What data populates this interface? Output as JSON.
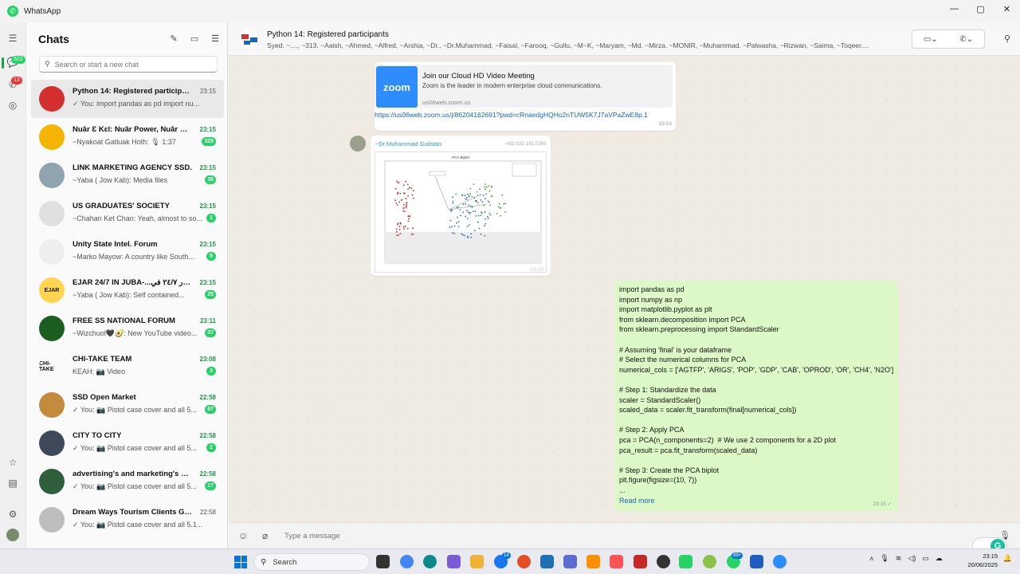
{
  "window": {
    "title": "WhatsApp",
    "minimize": "—",
    "maximize": "▢",
    "close": "✕"
  },
  "rail": {
    "chats_badge": "323",
    "status_badge": "13"
  },
  "sidebar": {
    "title": "Chats",
    "search_placeholder": "Search or start a new chat",
    "chats": [
      {
        "name": "Python 14: Registered participants",
        "preview": "✓ You: import pandas as pd import nu...",
        "time": "23:15",
        "count": "",
        "avatar_color": "#d32f2f",
        "avatar_text": ""
      },
      {
        "name": "Nuãr Ɛ Kɛl: Nuãr Power, Nuãr Bu...",
        "preview": "~Nyakoat Gatluak Hoth: 🎙 1:37",
        "time": "23:15",
        "count": "325",
        "avatar_color": "#f4b400",
        "avatar_text": ""
      },
      {
        "name": "LINK MARKETING AGENCY SSD.",
        "preview": "~Yaba      ( Jow Kab): Media files",
        "time": "23:15",
        "count": "35",
        "avatar_color": "#90a4ae",
        "avatar_text": ""
      },
      {
        "name": "US GRADUATES' SOCIETY",
        "preview": "~Chahan Ket Chan: Yeah, almost to so...",
        "time": "23:15",
        "count": "1",
        "avatar_color": "#e0e0e0",
        "avatar_text": ""
      },
      {
        "name": "Unity State Intel. Forum",
        "preview": "~Marko Mayow: A country like South...",
        "time": "23:15",
        "count": "5",
        "avatar_color": "#eeeeee",
        "avatar_text": ""
      },
      {
        "name": "EJAR 24/7 IN JUBA-...إيجار ٢٤/٧ في",
        "preview": "~Yaba      ( Jow Kab): Self contained...",
        "time": "23:15",
        "count": "25",
        "avatar_color": "#ffd54f",
        "avatar_text": "EJAR"
      },
      {
        "name": "FREE SS NATIONAL FORUM",
        "preview": "~Wizchuol🖤🥑: New YouTube video...",
        "time": "23:11",
        "count": "37",
        "avatar_color": "#1b5e20",
        "avatar_text": ""
      },
      {
        "name": "CHI-TAKE TEAM",
        "preview": "KEAH: 📷 Video",
        "time": "23:08",
        "count": "3",
        "avatar_color": "#fafafa",
        "avatar_text": "CHI-TAKE"
      },
      {
        "name": "SSD Open Market",
        "preview": "✓ You: 📷 Pistol case cover  and all 5...",
        "time": "22:58",
        "count": "67",
        "avatar_color": "#c58b3c",
        "avatar_text": ""
      },
      {
        "name": "CITY TO CITY",
        "preview": "✓ You: 📷 Pistol case cover  and all 5...",
        "time": "22:58",
        "count": "2",
        "avatar_color": "#3e4a5a",
        "avatar_text": ""
      },
      {
        "name": "advertising's and marketing's 🏠...",
        "preview": "✓ You: 📷 Pistol case cover  and all 5...",
        "time": "22:58",
        "count": "17",
        "avatar_color": "#2e5e3a",
        "avatar_text": ""
      },
      {
        "name": "Dream Ways Tourism Clients Gro...",
        "preview": "✓ You: 📷 Pistol case cover  and all 5.1...",
        "time": "22:58",
        "count": "",
        "avatar_color": "#bdbdbd",
        "avatar_text": ""
      }
    ]
  },
  "conversation": {
    "title": "Python 14: Registered participants",
    "members": "Syed. ~...., ~313. ~Aaish, ~Ahmed, ~Alfred, ~Arshia, ~Dr., ~Dr.Muhammad, ~Faisal, ~Farooq, ~Gullu, ~M~K, ~Maryam, ~Md. ~Mirza, ~MONIR, ~Muhammad. ~Palwasha, ~Rizwan, ~Saima, ~Toqeer....",
    "link_message": {
      "logo_text": "zoom",
      "title": "Join our Cloud HD Video Meeting",
      "description": "Zoom is the leader in modern enterprise cloud communications.",
      "domain": "us06web.zoom.us",
      "url": "https://us06web.zoom.us/j/86204162691?pwd=cRnaedgHQHo2nTUW5K7J7aVPaZwE8p.1",
      "time": "23:03"
    },
    "image_message": {
      "sender": "~Dr.Muhammad Gulistan",
      "phone": "+92 332 1917165",
      "time": "23:15",
      "plot_title": "PCA Biplot"
    },
    "code_message": {
      "lines": [
        "import pandas as pd",
        "import numpy as np",
        "import matplotlib.pyplot as plt",
        "from sklearn.decomposition import PCA",
        "from sklearn.preprocessing import StandardScaler",
        "",
        "# Assuming 'final' is your dataframe",
        "# Select the numerical columns for PCA",
        "numerical_cols = ['AGTFP', 'ARIGS', 'POP', 'GDP', 'CAB', 'OPROD', 'OR', 'CH4', 'N2O']",
        "",
        "# Step 1: Standardize the data",
        "scaler = StandardScaler()",
        "scaled_data = scaler.fit_transform(final[numerical_cols])",
        "",
        "# Step 2: Apply PCA",
        "pca = PCA(n_components=2)  # We use 2 components for a 2D plot",
        "pca_result = pca.fit_transform(scaled_data)",
        "",
        "# Step 3: Create the PCA biplot",
        "plt.figure(figsize=(10, 7))",
        "..."
      ],
      "read_more": "Read more",
      "time": "23:15 ✓"
    },
    "composer_placeholder": "Type a message"
  },
  "taskbar": {
    "search_label": "Search",
    "badge_1": "14",
    "badge_2": "99+",
    "clock_time": "23:15",
    "clock_date": "20/06/2025"
  }
}
